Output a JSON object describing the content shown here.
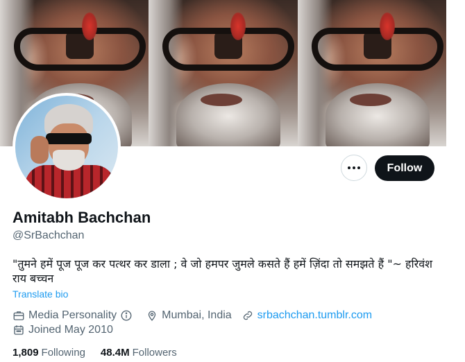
{
  "profile": {
    "name": "Amitabh Bachchan",
    "handle": "@SrBachchan",
    "bio": "\"तुमने हमें पूज पूज कर पत्थर कर डाला ; वे जो हमपर जुमले कसते हैं हमें ज़िंदा तो समझते हैं \"~ हरिवंश राय  बच्चन",
    "translate_label": "Translate bio",
    "category": "Media Personality",
    "location": "Mumbai, India",
    "website": "srbachchan.tumblr.com",
    "joined": "Joined May 2010"
  },
  "actions": {
    "follow_label": "Follow"
  },
  "stats": {
    "following_count": "1,809",
    "following_label": "Following",
    "followers_count": "48.4M",
    "followers_label": "Followers"
  },
  "icons": {
    "more": "more-horizontal-icon",
    "category": "briefcase-icon",
    "info": "info-circle-icon",
    "location": "location-pin-icon",
    "website": "link-icon",
    "joined": "calendar-icon"
  },
  "colors": {
    "text": "#0f1419",
    "secondary": "#536471",
    "link": "#1d9bf0",
    "button": "#0f1419"
  }
}
